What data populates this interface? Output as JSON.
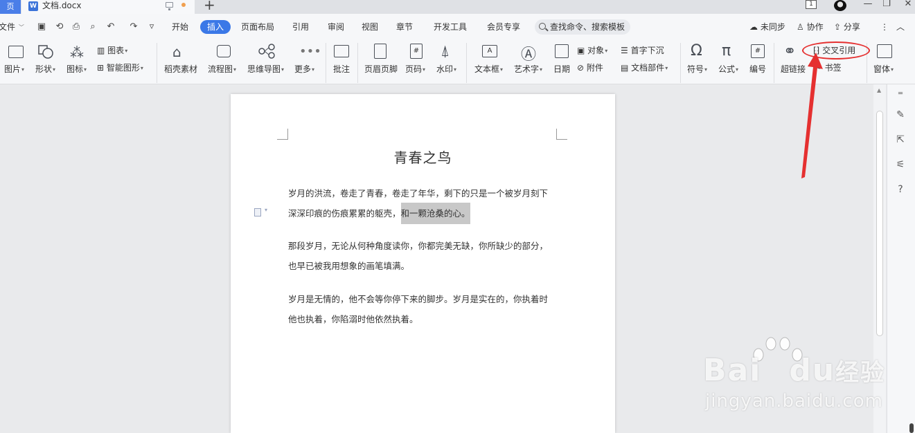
{
  "titlebar": {
    "home_tab": "页",
    "doc_tab_title": "文档.docx",
    "new_tab": "+",
    "page_count": "1",
    "minimize": "—",
    "restore": "❐",
    "close": "✕"
  },
  "menubar": {
    "file_menu": "文件",
    "tabs": [
      "开始",
      "插入",
      "页面布局",
      "引用",
      "审阅",
      "视图",
      "章节",
      "开发工具",
      "会员专享"
    ],
    "active_tab_index": 1,
    "search_placeholder": "查找命令、搜索模板",
    "right": {
      "sync": "未同步",
      "collab": "协作",
      "share": "分享"
    }
  },
  "ribbon": {
    "picture": "图片",
    "shape": "形状",
    "icons": "图标",
    "chart": "图表",
    "smart_shape": "智能图形",
    "material": "稻壳素材",
    "flowchart": "流程图",
    "mindmap": "思维导图",
    "more": "更多",
    "comment": "批注",
    "header_footer": "页眉页脚",
    "page_number": "页码",
    "watermark": "水印",
    "textbox": "文本框",
    "wordart": "艺术字",
    "date": "日期",
    "object": "对象",
    "attachment": "附件",
    "drop_cap": "首字下沉",
    "doc_parts": "文档部件",
    "symbol": "符号",
    "formula": "公式",
    "numbering": "编号",
    "hyperlink": "超链接",
    "cross_ref": "交叉引用",
    "bookmark": "书签",
    "window": "窗体"
  },
  "document": {
    "title": "青春之鸟",
    "paragraphs": [
      {
        "line1": "岁月的洪流，卷走了青春，卷走了年华，剩下的只是一个被岁月刻下",
        "line2_normal": "深深印痕的伤痕累累的躯壳，",
        "line2_highlight": "和一颗沧桑的心。"
      },
      {
        "line1": "那段岁月，无论从何种角度读你，你都完美无缺，你所缺少的部分，",
        "line2": "也早已被我用想象的画笔填满。"
      },
      {
        "line1": "岁月是无情的，他不会等你停下来的脚步。岁月是实在的，你执着时",
        "line2": "他也执着，你陷溺时他依然执着。"
      }
    ]
  },
  "watermark": {
    "logo_left": "Bai",
    "logo_right": "du",
    "logo_cn": "经验",
    "url": "jingyan.baidu.com"
  },
  "colors": {
    "accent": "#3b78e7",
    "annotation": "#e53030"
  }
}
